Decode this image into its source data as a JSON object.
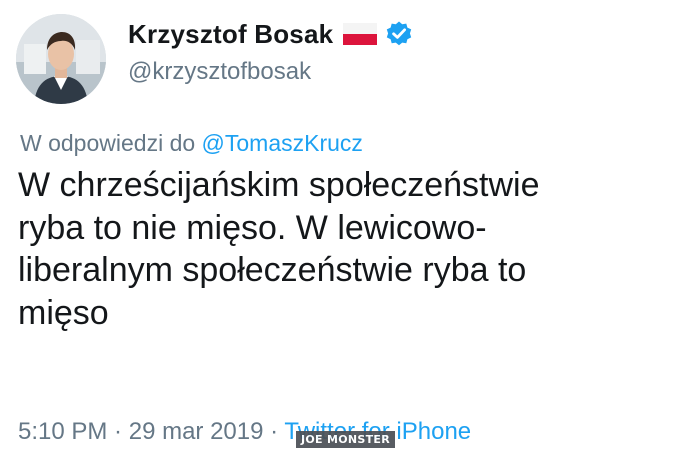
{
  "author": {
    "display_name": "Krzysztof Bosak",
    "handle": "@krzysztofbosak",
    "flag_icon": "poland-flag-icon",
    "verified_icon": "verified-badge-icon"
  },
  "reply": {
    "prefix": "W odpowiedzi do ",
    "mention": "@TomaszKrucz"
  },
  "tweet_text_lines": [
    "W chrześcijańskim społeczeństwie",
    "ryba to nie mięso. W lewicowo-",
    "liberalnym społeczeństwie ryba to",
    "mięso"
  ],
  "meta": {
    "time": "5:10 PM",
    "separator": " · ",
    "date": "29 mar 2019",
    "separator2": " · ",
    "source": "Twitter for iPhone"
  },
  "watermark": "JOE MONSTER",
  "colors": {
    "text": "#14171a",
    "secondary": "#657786",
    "link": "#1da1f2",
    "verified": "#1da1f2",
    "flag_red": "#dc143c"
  }
}
